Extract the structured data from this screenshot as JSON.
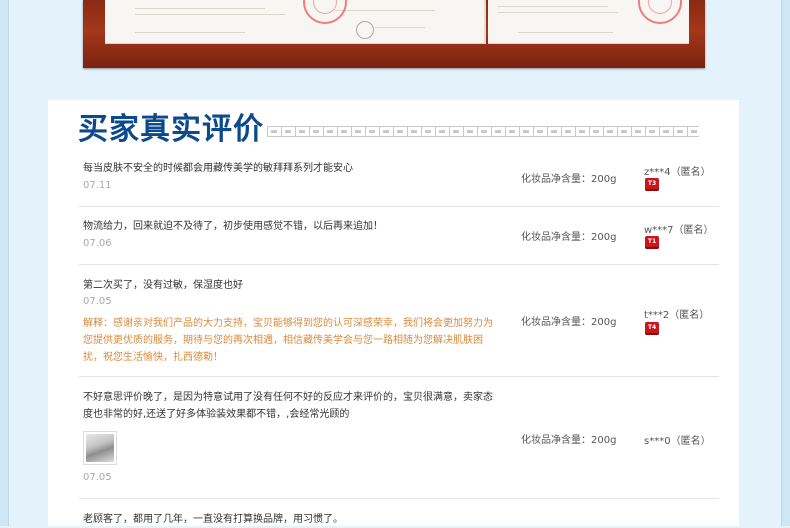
{
  "section_title": "买家真实评价",
  "reviews": [
    {
      "comment": "每当皮肤不安全的时候都会用藏传美学的敏拜拜系列才能安心",
      "date": "07.11",
      "spec": "化妆品净含量：200g",
      "user": "z***4（匿名）",
      "badge": "T3"
    },
    {
      "comment": "物流给力，回来就迫不及待了，初步使用感觉不错，以后再来追加！",
      "date": "07.06",
      "spec": "化妆品净含量：200g",
      "user": "w***7（匿名）",
      "badge": "T1"
    },
    {
      "comment": "第二次买了，没有过敏，保湿度也好",
      "date": "07.05",
      "reply": "解释：感谢亲对我们产品的大力支持，宝贝能够得到您的认可深感荣幸，我们将会更加努力为您提供更优质的服务，期待与您的再次相遇，相信藏传美学会与您一路相随为您解决肌肤困扰，祝您生活愉快，扎西德勒！",
      "spec": "化妆品净含量：200g",
      "user": "t***2（匿名）",
      "badge": "T4"
    },
    {
      "comment": "不好意思评价晚了，是因为特意试用了没有任何不好的反应才来评价的，宝贝很满意，卖家态度也非常的好,还送了好多体验装效果都不错，,会经常光顾的",
      "date": "07.05",
      "spec": "化妆品净含量：200g",
      "user": "s***0（匿名）"
    },
    {
      "comment": "老顾客了，都用了几年，一直没有打算换品牌，用习惯了。"
    }
  ]
}
